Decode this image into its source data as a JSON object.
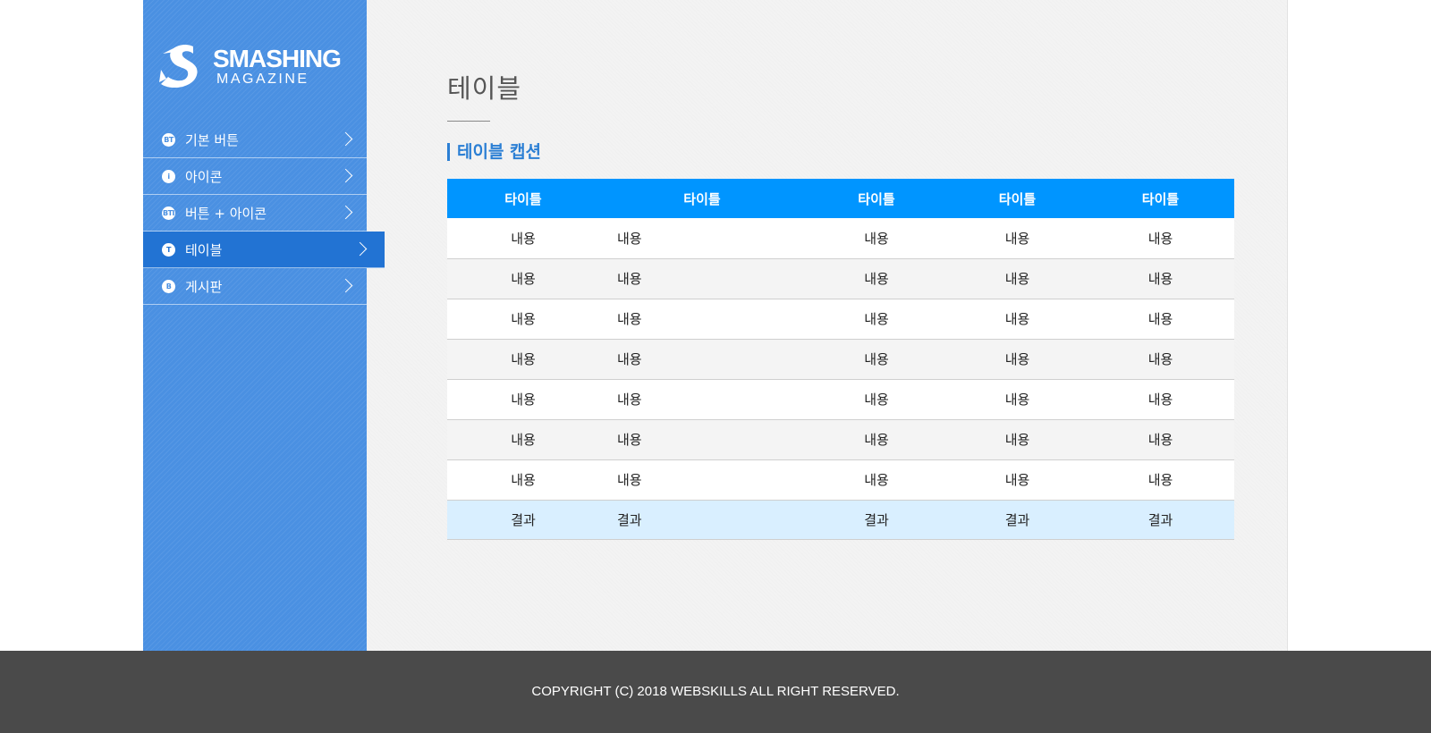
{
  "brand": {
    "name": "SMASHING",
    "tagline": "MAGAZINE"
  },
  "colors": {
    "sidebar": "#4a90e2",
    "active_item": "#2273d3",
    "table_header": "#0095ff",
    "footer": "#4a4a4a",
    "caption": "#2b7fd4"
  },
  "nav": {
    "items": [
      {
        "icon_text": "BT",
        "label": "기본 버튼",
        "icon": "bt-circle-icon"
      },
      {
        "icon_text": "i",
        "label": "아이콘",
        "icon": "info-circle-icon"
      },
      {
        "icon_text": "BTI",
        "label": "버튼 + 아이콘",
        "icon": "bti-circle-icon"
      },
      {
        "icon_text": "T",
        "label": "테이블",
        "icon": "t-circle-icon",
        "active": true
      },
      {
        "icon_text": "B",
        "label": "게시판",
        "icon": "b-circle-icon"
      }
    ]
  },
  "main": {
    "page_title": "테이블",
    "caption": "테이블 캡션",
    "table": {
      "headers": [
        "타이틀",
        "타이틀",
        "타이틀",
        "타이틀",
        "타이틀"
      ],
      "rows": [
        [
          "내용",
          "내용",
          "내용",
          "내용",
          "내용"
        ],
        [
          "내용",
          "내용",
          "내용",
          "내용",
          "내용"
        ],
        [
          "내용",
          "내용",
          "내용",
          "내용",
          "내용"
        ],
        [
          "내용",
          "내용",
          "내용",
          "내용",
          "내용"
        ],
        [
          "내용",
          "내용",
          "내용",
          "내용",
          "내용"
        ],
        [
          "내용",
          "내용",
          "내용",
          "내용",
          "내용"
        ],
        [
          "내용",
          "내용",
          "내용",
          "내용",
          "내용"
        ]
      ],
      "footer": [
        "결과",
        "결과",
        "결과",
        "결과",
        "결과"
      ]
    }
  },
  "footer": {
    "copyright": "COPYRIGHT (C) 2018 WEBSKILLS ALL RIGHT RESERVED."
  }
}
